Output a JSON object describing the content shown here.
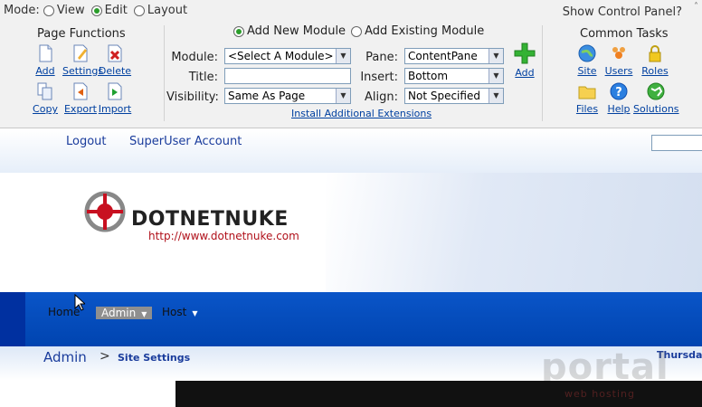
{
  "mode": {
    "label": "Mode:",
    "options": [
      "View",
      "Edit",
      "Layout"
    ],
    "selected": "Edit"
  },
  "show_control_panel": "Show Control Panel?",
  "page_functions": {
    "title": "Page Functions",
    "buttons": [
      "Add",
      "Settings",
      "Delete",
      "Copy",
      "Export",
      "Import"
    ]
  },
  "module": {
    "add_new_label": "Add New Module",
    "add_existing_label": "Add Existing Module",
    "module_label": "Module:",
    "module_value": "<Select A Module>",
    "title_label": "Title:",
    "title_value": "",
    "visibility_label": "Visibility:",
    "visibility_value": "Same As Page",
    "pane_label": "Pane:",
    "pane_value": "ContentPane",
    "insert_label": "Insert:",
    "insert_value": "Bottom",
    "align_label": "Align:",
    "align_value": "Not Specified",
    "add_label": "Add",
    "install_link": "Install Additional Extensions"
  },
  "common_tasks": {
    "title": "Common Tasks",
    "buttons": [
      "Site",
      "Users",
      "Roles",
      "Files",
      "Help",
      "Solutions"
    ]
  },
  "site": {
    "logout": "Logout",
    "account": "SuperUser Account",
    "logo_text": "DOTNETNUKE",
    "logo_url": "http://www.dotnetnuke.com",
    "nav": [
      "Home",
      "Admin",
      "Host"
    ],
    "nav_selected": "Admin",
    "breadcrumb_title": "Admin",
    "breadcrumb_sep": ">",
    "breadcrumb_page": "Site Settings",
    "date_text": "Thursday",
    "watermark": "portal",
    "watermark_sub": "web hosting"
  }
}
